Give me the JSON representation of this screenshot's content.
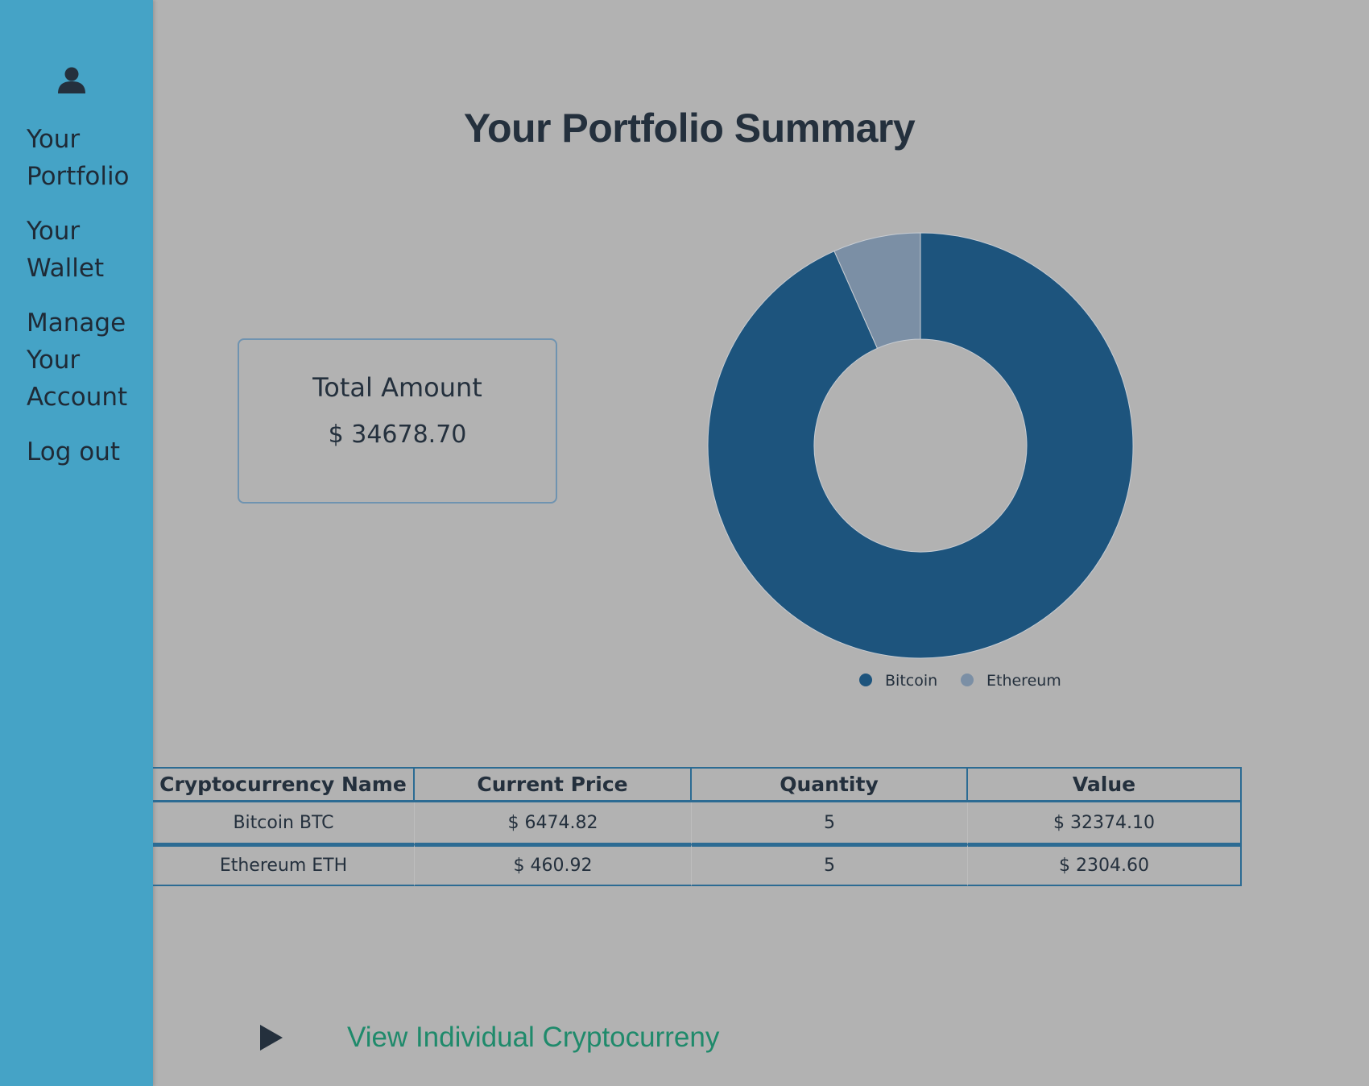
{
  "sidebar": {
    "user_icon": "user-icon",
    "items": [
      {
        "label": "Your Portfolio"
      },
      {
        "label": "Your Wallet"
      },
      {
        "label": "Manage Your Account"
      },
      {
        "label": "Log out"
      }
    ]
  },
  "main": {
    "title": "Your Portfolio Summary",
    "total": {
      "label": "Total Amount",
      "value": "$ 34678.70"
    },
    "table": {
      "headers": [
        "Cryptocurrency Name",
        "Current Price",
        "Quantity",
        "Value"
      ],
      "rows": [
        [
          "Bitcoin BTC",
          "$ 6474.82",
          "5",
          "$ 32374.10"
        ],
        [
          "Ethereum ETH",
          "$ 460.92",
          "5",
          "$ 2304.60"
        ]
      ]
    },
    "footer_link": {
      "icon": "play-icon",
      "label": "View Individual Cryptocurreny"
    }
  },
  "colors": {
    "sidebar_bg": "#45a3c6",
    "page_bg": "#b2b2b2",
    "bitcoin": "#1d547d",
    "ethereum": "#7b8fa5",
    "link": "#1f8a6b"
  },
  "chart_data": {
    "type": "pie",
    "variant": "doughnut",
    "labels": [
      "Bitcoin",
      "Ethereum"
    ],
    "values": [
      32374.1,
      2304.6
    ],
    "colors": [
      "#1d547d",
      "#7b8fa5"
    ],
    "legend_position": "bottom"
  }
}
